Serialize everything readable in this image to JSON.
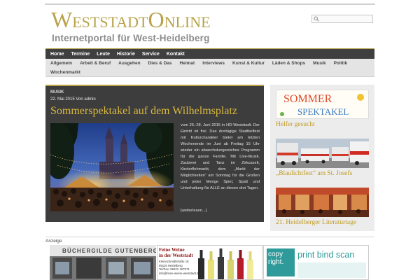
{
  "header": {
    "logo_w": "W",
    "logo_eststadt": "ESTSTADT",
    "logo_o": "O",
    "logo_nline": "NLINE",
    "subtitle": "Internetportal für West-Heidelberg",
    "search_placeholder": ""
  },
  "main_nav": [
    "Home",
    "Termine",
    "Leute",
    "Historie",
    "Service",
    "Kontakt"
  ],
  "sub_nav_row1": [
    "Allgemein",
    "Arbeit & Beruf",
    "Ausgehen",
    "Dies & Das",
    "Heimat",
    "Interviews",
    "Kunst & Kultur",
    "Läden & Shops",
    "Musik",
    "Politik"
  ],
  "sub_nav_row2": [
    "Wochenmarkt"
  ],
  "featured": {
    "category": "MUSIK",
    "date": "22. Mai 2015 Von admin",
    "title": "Sommerspektakel auf dem Wilhelmsplatz",
    "text": "vom 26.-28. Juni 2015 in HD-Weststadt. Der Eintritt ist frei. Das dreitägige Stadtteilfest mit Kulturcharakter bietet am letzten Wochenende im Juni ab Freitag 15 Uhr wieder ein abwechslungsreiches Programm für die ganze Familie. Mit Live-Musik, Zauberei und Tanz im Zirkuszelt, Kinderflohmarkt, dem „Markt der Möglichkeiten“ am Sonntag für die Großen und jeder Menge Spiel, Spaß und Unterhaltung für ALLE an diesen drei Tagen.",
    "more": "[weiterlesen...]"
  },
  "sidebar": [
    {
      "label": "Helfer gesucht",
      "banner_text_1": "SOMMER",
      "banner_text_2": "SPEKTAKEL"
    },
    {
      "label": "„Blaulichtfest“ am St. Josefs"
    },
    {
      "label": "21. Heidelberger Literaturtage"
    }
  ],
  "ads_label": "Anzeige",
  "ads": {
    "bookstore_sign": "BÜCHERGILDE GUTENBERG",
    "wine_title_1": "Feine Weine",
    "wine_title_2": "in der Weststadt",
    "wine_addr_1": "Kleinschmidtstraße 18",
    "wine_addr_2": "69115 Heidelberg",
    "wine_addr_3": "Tel/Fax: 06221 167571",
    "wine_addr_4": "info@feine-weine-weststadt.de",
    "copy_logo_1": "copy",
    "copy_logo_2": "right.",
    "copy_slogan": "print bind scan"
  },
  "colors": {
    "accent_gold": "#b8a248",
    "nav_dark": "#3f3f3f",
    "title_gold": "#d9b83e",
    "sidebar_label": "#c09a23",
    "copy_green": "#2f9a9a"
  }
}
